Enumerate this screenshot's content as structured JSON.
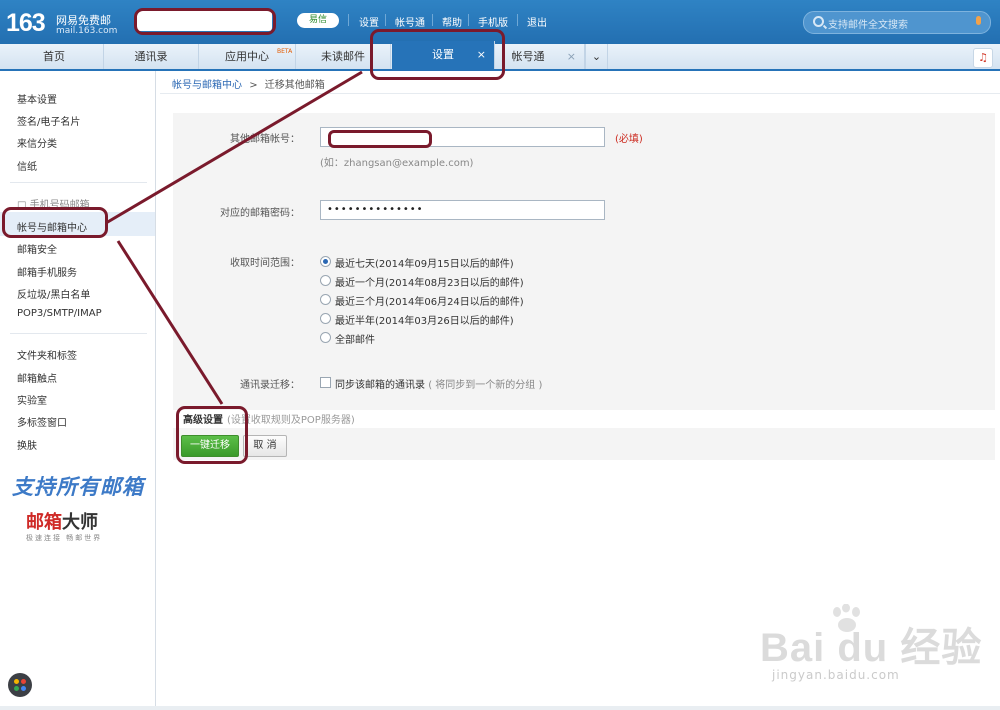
{
  "header": {
    "logo_number": "163",
    "logo_title": "网易免费邮",
    "logo_domain": "mail.163.com",
    "yixin_label": "易信",
    "links": [
      "设置",
      "帐号通",
      "帮助",
      "手机版",
      "退出"
    ],
    "search_placeholder": "支持邮件全文搜索"
  },
  "tabs": [
    {
      "label": "首页"
    },
    {
      "label": "通讯录"
    },
    {
      "label": "应用中心",
      "badge": "BETA"
    },
    {
      "label": "未读邮件"
    },
    {
      "label": "设置",
      "active": true,
      "close": "×"
    },
    {
      "label": "帐号通",
      "close": "×"
    }
  ],
  "tab_more": "⌄",
  "music_icon": "♫",
  "sidebar": {
    "group1": [
      "基本设置",
      "签名/电子名片",
      "来信分类",
      "信纸"
    ],
    "group2_header": "□ 手机号码邮箱",
    "group2": [
      "帐号与邮箱中心",
      "邮箱安全",
      "邮箱手机服务",
      "反垃圾/黑白名单",
      "POP3/SMTP/IMAP"
    ],
    "group3": [
      "文件夹和标签",
      "邮箱触点",
      "实验室",
      "多标签窗口",
      "换肤"
    ],
    "active_item": "帐号与邮箱中心",
    "promo": {
      "line1": "支持所有邮箱",
      "brand_a": "邮箱",
      "brand_b": "大师",
      "tagline": "极速连接 畅邮世界"
    }
  },
  "breadcrumb": {
    "parent": "帐号与邮箱中心",
    "separator": ">",
    "current": "迁移其他邮箱"
  },
  "form": {
    "email_label": "其他邮箱帐号：",
    "required": "(必填)",
    "email_hint": "(如：zhangsan@example.com)",
    "password_label": "对应的邮箱密码：",
    "password_value": "••••••••••••••",
    "range_label": "收取时间范围：",
    "range_options": [
      "最近七天(2014年09月15日以后的邮件)",
      "最近一个月(2014年08月23日以后的邮件)",
      "最近三个月(2014年06月24日以后的邮件)",
      "最近半年(2014年03月26日以后的邮件)",
      "全部邮件"
    ],
    "selected_range": 0,
    "contacts_label": "通讯录迁移：",
    "contacts_checkbox": "同步该邮箱的通讯录",
    "contacts_note": "( 将同步到一个新的分组 )",
    "contacts_checked": false
  },
  "advanced": {
    "title": "高级设置",
    "note": "(设置收取规则及POP服务器)"
  },
  "buttons": {
    "migrate": "一键迁移",
    "cancel": "取 消"
  },
  "watermark": {
    "main": "Bai du 经验",
    "sub": "jingyan.baidu.com"
  },
  "colors": {
    "header_blue": "#2673b8",
    "annotation": "#7a1a2c",
    "primary_green": "#4aad38",
    "required_red": "#cc2a1f"
  }
}
